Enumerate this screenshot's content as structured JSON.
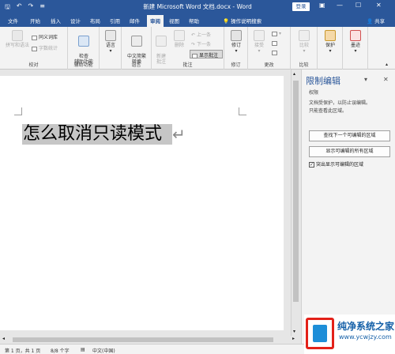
{
  "titlebar": {
    "title": "新建 Microsoft Word 文档.docx - Word",
    "login": "登录",
    "save_icon": "save-icon",
    "undo_icon": "undo-icon",
    "redo_icon": "redo-icon",
    "customize_icon": "qat-customize-icon",
    "ribbon_options_icon": "ribbon-display-options-icon"
  },
  "tabs": [
    "文件",
    "开始",
    "插入",
    "设计",
    "布局",
    "引用",
    "邮件",
    "审阅",
    "视图",
    "帮助"
  ],
  "active_tab": "审阅",
  "tell_me": "操作说明搜索",
  "share": "共享",
  "ribbon": {
    "proofing": {
      "label": "校对",
      "spelling": "拼写和语法",
      "thesaurus": "同义词库",
      "word_count": "字数统计"
    },
    "accessibility": {
      "label": "辅助功能",
      "check": "检查\n辅助功能"
    },
    "language": {
      "label": "语言",
      "button": "语言"
    },
    "chinese": {
      "convert": "中文简繁\n转换"
    },
    "comments": {
      "label": "批注",
      "new": "新建\n批注",
      "delete": "删除",
      "prev": "上一条",
      "next": "下一条",
      "show": "显示批注"
    },
    "tracking": {
      "label": "修订",
      "button": "修订"
    },
    "changes": {
      "label": "更改",
      "accept": "接受"
    },
    "compare": {
      "label": "比较",
      "button": "比较"
    },
    "protect": {
      "button": "保护"
    },
    "ink": {
      "button": "墨迹"
    }
  },
  "document": {
    "heading": "怎么取消只读模式",
    "paragraph_mark": "↵"
  },
  "pane": {
    "title": "限制编辑",
    "dropdown": "▾",
    "close": "✕",
    "subtitle": "权限",
    "description_line1": "文档受保护，以防止误编辑。",
    "description_line2": "只能查看此区域。",
    "btn_next_region": "查找下一个可编辑的区域",
    "btn_show_all": "显示可编辑的所有区域",
    "highlight_label": "突出显示可编辑的区域",
    "highlight_checked": true
  },
  "statusbar": {
    "page": "第 1 页，共 1 页",
    "words": "8/8 个字",
    "language": "中文(中国)"
  },
  "watermark": {
    "text": "纯净系统之家",
    "url": "www.ycwjzy.com"
  },
  "colors": {
    "accent": "#2b579a",
    "highlight": "#c6c6c6"
  }
}
